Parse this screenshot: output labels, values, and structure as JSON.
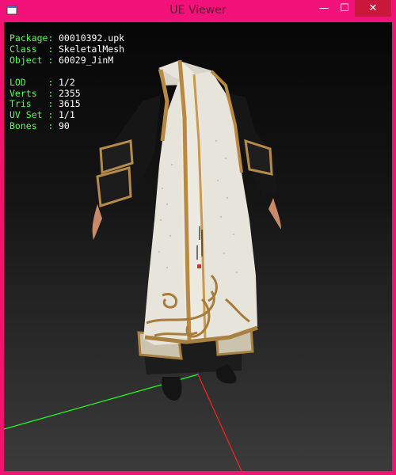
{
  "window": {
    "title": "UE Viewer",
    "controls": {
      "minimize": "—",
      "maximize": "☐",
      "close": "✕"
    },
    "accent": "#f2127a"
  },
  "info": {
    "package": {
      "label": "Package:",
      "value": "00010392.upk"
    },
    "class": {
      "label": "Class  :",
      "value": "SkeletalMesh"
    },
    "object": {
      "label": "Object :",
      "value": "60029_JinM"
    },
    "lod": {
      "label": "LOD    :",
      "value": "1/2"
    },
    "verts": {
      "label": "Verts  :",
      "value": "2355"
    },
    "tris": {
      "label": "Tris   :",
      "value": "3615"
    },
    "uvset": {
      "label": "UV Set :",
      "value": "1/1"
    },
    "bones": {
      "label": "Bones  :",
      "value": "90"
    }
  },
  "viewport": {
    "label_color": "#53ff53",
    "axis_colors": {
      "x": "#ff2020",
      "y": "#20ff20",
      "z": "#2030ff"
    }
  }
}
